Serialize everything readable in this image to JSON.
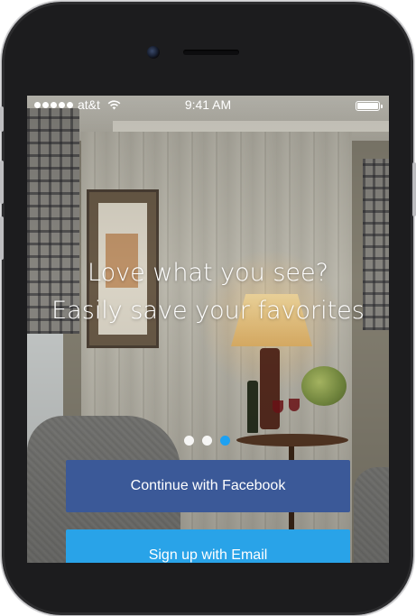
{
  "status_bar": {
    "carrier": "at&t",
    "time": "9:41 AM",
    "signal_bars": 5,
    "battery_level": 1.0
  },
  "onboarding": {
    "headline_line1": "Love what you see?",
    "headline_line2": "Easily save your favorites",
    "page_count": 3,
    "active_page": 3
  },
  "buttons": {
    "facebook_label": "Continue with Facebook",
    "email_label": "Sign up with Email"
  },
  "colors": {
    "facebook_blue": "#3b5998",
    "email_blue": "#29a3e8",
    "active_dot": "#1da1f2"
  },
  "icons": [
    "signal-dots-icon",
    "wifi-icon",
    "battery-icon"
  ]
}
